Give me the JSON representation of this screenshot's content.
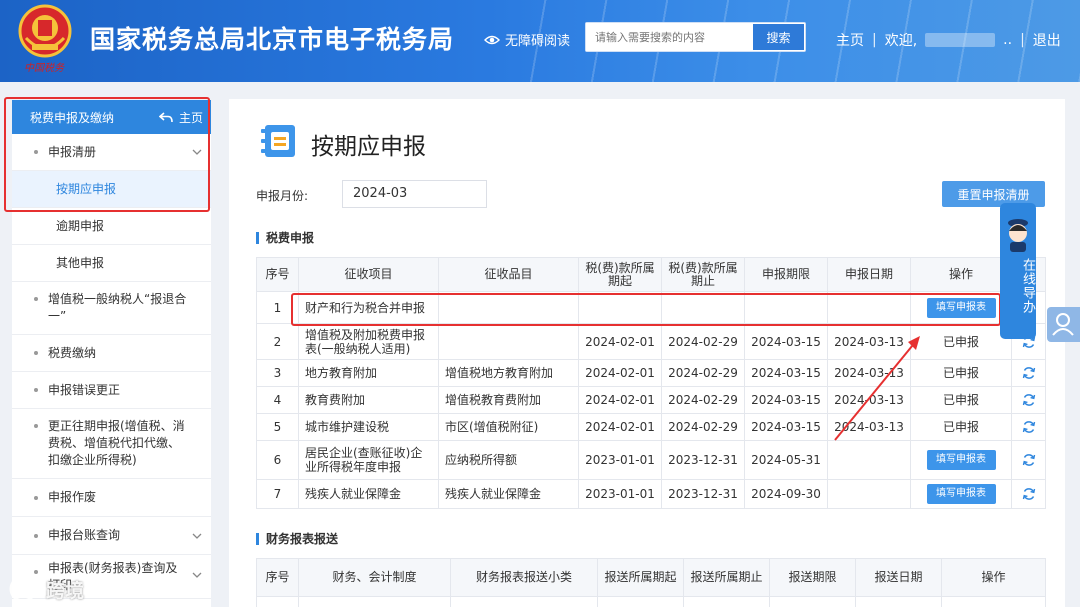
{
  "header": {
    "title": "国家税务总局北京市电子税务局",
    "emblem_script": "中国税务",
    "accessibility": "无障碍阅读",
    "search_placeholder": "请输入需要搜索的内容",
    "search_button": "搜索",
    "home": "主页",
    "welcome": "欢迎,",
    "name_suffix": "..",
    "logout": "退出"
  },
  "sidebar": {
    "header": "税费申报及缴纳",
    "home": "主页",
    "items": [
      {
        "label": "申报清册"
      },
      {
        "label": "按期应申报"
      },
      {
        "label": "逾期申报"
      },
      {
        "label": "其他申报"
      },
      {
        "label": "增值税一般纳税人“报退合一”"
      },
      {
        "label": "税费缴纳"
      },
      {
        "label": "申报错误更正"
      },
      {
        "label": "更正往期申报(增值税、消费税、增值税代扣代缴、扣缴企业所得税)"
      },
      {
        "label": "申报作废"
      },
      {
        "label": "申报台账查询"
      },
      {
        "label": "申报表(财务报表)查询及打印"
      }
    ]
  },
  "main": {
    "title": "按期应申报",
    "period_label": "申报月份:",
    "period_value": "2024-03",
    "reset_button": "重置申报清册",
    "section1_title": "税费申报",
    "section2_title": "财务报表报送",
    "table1": {
      "headers": [
        "序号",
        "征收项目",
        "征收品目",
        "税(费)款所属期起",
        "税(费)款所属期止",
        "申报期限",
        "申报日期",
        "操作"
      ],
      "rows": [
        {
          "no": "1",
          "item": "财产和行为税合并申报",
          "sub": "",
          "start": "",
          "end": "",
          "deadline": "",
          "date": "",
          "op": "填写申报表",
          "op_type": "button"
        },
        {
          "no": "2",
          "item": "增值税及附加税费申报表(一般纳税人适用)",
          "sub": "",
          "start": "2024-02-01",
          "end": "2024-02-29",
          "deadline": "2024-03-15",
          "date": "2024-03-13",
          "op": "已申报",
          "op_type": "text"
        },
        {
          "no": "3",
          "item": "地方教育附加",
          "sub": "增值税地方教育附加",
          "start": "2024-02-01",
          "end": "2024-02-29",
          "deadline": "2024-03-15",
          "date": "2024-03-13",
          "op": "已申报",
          "op_type": "text"
        },
        {
          "no": "4",
          "item": "教育费附加",
          "sub": "增值税教育费附加",
          "start": "2024-02-01",
          "end": "2024-02-29",
          "deadline": "2024-03-15",
          "date": "2024-03-13",
          "op": "已申报",
          "op_type": "text"
        },
        {
          "no": "5",
          "item": "城市维护建设税",
          "sub": "市区(增值税附征)",
          "start": "2024-02-01",
          "end": "2024-02-29",
          "deadline": "2024-03-15",
          "date": "2024-03-13",
          "op": "已申报",
          "op_type": "text"
        },
        {
          "no": "6",
          "item": "居民企业(查账征收)企业所得税年度申报",
          "sub": "应纳税所得额",
          "start": "2023-01-01",
          "end": "2023-12-31",
          "deadline": "2024-05-31",
          "date": "",
          "op": "填写申报表",
          "op_type": "button"
        },
        {
          "no": "7",
          "item": "残疾人就业保障金",
          "sub": "残疾人就业保障金",
          "start": "2023-01-01",
          "end": "2023-12-31",
          "deadline": "2024-09-30",
          "date": "",
          "op": "填写申报表",
          "op_type": "button"
        }
      ]
    },
    "table2": {
      "headers": [
        "序号",
        "财务、会计制度",
        "财务报表报送小类",
        "报送所属期起",
        "报送所属期止",
        "报送期限",
        "报送日期",
        "操作"
      ]
    }
  },
  "assistant": {
    "label": "在线导办"
  },
  "watermark": "跨境",
  "colors": {
    "primary": "#2e86de",
    "header_start": "#1c63c6",
    "highlight": "#e63030",
    "button": "#3d95ea"
  }
}
